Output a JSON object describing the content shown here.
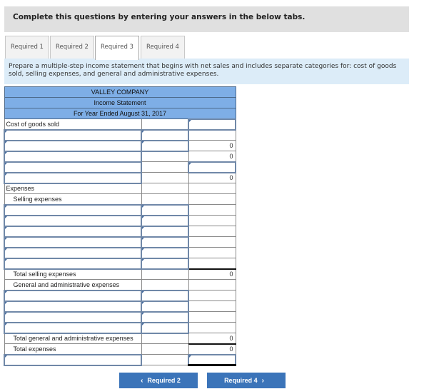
{
  "instructions": "Complete this questions by entering your answers in the below tabs.",
  "tabs": [
    {
      "label": "Required 1",
      "active": false
    },
    {
      "label": "Required 2",
      "active": false
    },
    {
      "label": "Required 3",
      "active": true
    },
    {
      "label": "Required 4",
      "active": false
    }
  ],
  "prompt": "Prepare a multiple-step income statement that begins with net sales and includes separate categories for: cost of goods sold, selling expenses, and general and administrative expenses.",
  "statement": {
    "company": "VALLEY COMPANY",
    "title": "Income Statement",
    "period": "For Year Ended August 31, 2017",
    "labels": {
      "cogs": "Cost of goods sold",
      "expenses": "Expenses",
      "selling": "Selling expenses",
      "total_selling": "Total selling expenses",
      "ga": "General and administrative expenses",
      "total_ga": "Total general and administrative expenses",
      "total_expenses": "Total expenses"
    },
    "values": {
      "cogs_row3": "0",
      "cogs_row4": "0",
      "cogs_row6": "0",
      "total_selling": "0",
      "total_ga": "0",
      "total_expenses": "0"
    }
  },
  "nav": {
    "prev_label": "Required 2",
    "next_label": "Required 4",
    "prev_icon": "chevron-left-icon",
    "next_icon": "chevron-right-icon"
  }
}
